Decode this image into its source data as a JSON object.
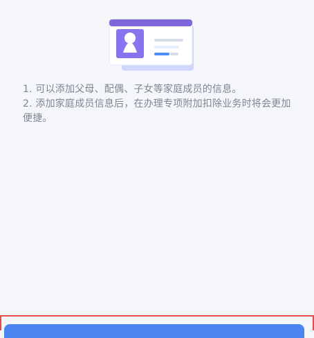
{
  "illustration": {
    "icon": "contact-card-icon",
    "colors": {
      "card_back": "#cfd7ff",
      "card_front": "#ffffff",
      "header": "#7f66db",
      "avatar_bg": "#8a73ee",
      "avatar_person": "#ffffff",
      "line_1": "#d6dce8",
      "line_2": "#e7f0ff",
      "line_3": "#4d8df7"
    }
  },
  "info": {
    "line_1": "1. 可以添加父母、配偶、子女等家庭成员的信息。",
    "line_2": "2. 添加家庭成员信息后，在办理专项附加扣除业务时将会更加便捷。"
  },
  "bottom_action": {
    "label": "",
    "button_color": "#4b86f0",
    "highlight_color": "#e44b4b"
  }
}
